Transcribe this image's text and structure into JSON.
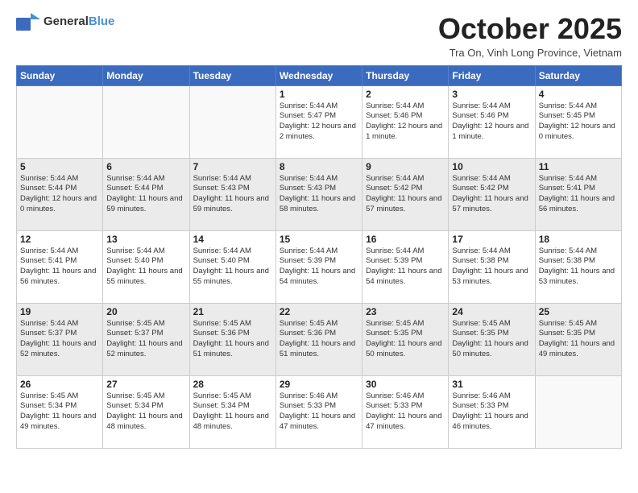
{
  "header": {
    "logo_general": "General",
    "logo_blue": "Blue",
    "month_title": "October 2025",
    "subtitle": "Tra On, Vinh Long Province, Vietnam"
  },
  "days_of_week": [
    "Sunday",
    "Monday",
    "Tuesday",
    "Wednesday",
    "Thursday",
    "Friday",
    "Saturday"
  ],
  "weeks": [
    [
      {
        "day": "",
        "info": ""
      },
      {
        "day": "",
        "info": ""
      },
      {
        "day": "",
        "info": ""
      },
      {
        "day": "1",
        "info": "Sunrise: 5:44 AM\nSunset: 5:47 PM\nDaylight: 12 hours\nand 2 minutes."
      },
      {
        "day": "2",
        "info": "Sunrise: 5:44 AM\nSunset: 5:46 PM\nDaylight: 12 hours\nand 1 minute."
      },
      {
        "day": "3",
        "info": "Sunrise: 5:44 AM\nSunset: 5:46 PM\nDaylight: 12 hours\nand 1 minute."
      },
      {
        "day": "4",
        "info": "Sunrise: 5:44 AM\nSunset: 5:45 PM\nDaylight: 12 hours\nand 0 minutes."
      }
    ],
    [
      {
        "day": "5",
        "info": "Sunrise: 5:44 AM\nSunset: 5:44 PM\nDaylight: 12 hours\nand 0 minutes."
      },
      {
        "day": "6",
        "info": "Sunrise: 5:44 AM\nSunset: 5:44 PM\nDaylight: 11 hours\nand 59 minutes."
      },
      {
        "day": "7",
        "info": "Sunrise: 5:44 AM\nSunset: 5:43 PM\nDaylight: 11 hours\nand 59 minutes."
      },
      {
        "day": "8",
        "info": "Sunrise: 5:44 AM\nSunset: 5:43 PM\nDaylight: 11 hours\nand 58 minutes."
      },
      {
        "day": "9",
        "info": "Sunrise: 5:44 AM\nSunset: 5:42 PM\nDaylight: 11 hours\nand 57 minutes."
      },
      {
        "day": "10",
        "info": "Sunrise: 5:44 AM\nSunset: 5:42 PM\nDaylight: 11 hours\nand 57 minutes."
      },
      {
        "day": "11",
        "info": "Sunrise: 5:44 AM\nSunset: 5:41 PM\nDaylight: 11 hours\nand 56 minutes."
      }
    ],
    [
      {
        "day": "12",
        "info": "Sunrise: 5:44 AM\nSunset: 5:41 PM\nDaylight: 11 hours\nand 56 minutes."
      },
      {
        "day": "13",
        "info": "Sunrise: 5:44 AM\nSunset: 5:40 PM\nDaylight: 11 hours\nand 55 minutes."
      },
      {
        "day": "14",
        "info": "Sunrise: 5:44 AM\nSunset: 5:40 PM\nDaylight: 11 hours\nand 55 minutes."
      },
      {
        "day": "15",
        "info": "Sunrise: 5:44 AM\nSunset: 5:39 PM\nDaylight: 11 hours\nand 54 minutes."
      },
      {
        "day": "16",
        "info": "Sunrise: 5:44 AM\nSunset: 5:39 PM\nDaylight: 11 hours\nand 54 minutes."
      },
      {
        "day": "17",
        "info": "Sunrise: 5:44 AM\nSunset: 5:38 PM\nDaylight: 11 hours\nand 53 minutes."
      },
      {
        "day": "18",
        "info": "Sunrise: 5:44 AM\nSunset: 5:38 PM\nDaylight: 11 hours\nand 53 minutes."
      }
    ],
    [
      {
        "day": "19",
        "info": "Sunrise: 5:44 AM\nSunset: 5:37 PM\nDaylight: 11 hours\nand 52 minutes."
      },
      {
        "day": "20",
        "info": "Sunrise: 5:45 AM\nSunset: 5:37 PM\nDaylight: 11 hours\nand 52 minutes."
      },
      {
        "day": "21",
        "info": "Sunrise: 5:45 AM\nSunset: 5:36 PM\nDaylight: 11 hours\nand 51 minutes."
      },
      {
        "day": "22",
        "info": "Sunrise: 5:45 AM\nSunset: 5:36 PM\nDaylight: 11 hours\nand 51 minutes."
      },
      {
        "day": "23",
        "info": "Sunrise: 5:45 AM\nSunset: 5:35 PM\nDaylight: 11 hours\nand 50 minutes."
      },
      {
        "day": "24",
        "info": "Sunrise: 5:45 AM\nSunset: 5:35 PM\nDaylight: 11 hours\nand 50 minutes."
      },
      {
        "day": "25",
        "info": "Sunrise: 5:45 AM\nSunset: 5:35 PM\nDaylight: 11 hours\nand 49 minutes."
      }
    ],
    [
      {
        "day": "26",
        "info": "Sunrise: 5:45 AM\nSunset: 5:34 PM\nDaylight: 11 hours\nand 49 minutes."
      },
      {
        "day": "27",
        "info": "Sunrise: 5:45 AM\nSunset: 5:34 PM\nDaylight: 11 hours\nand 48 minutes."
      },
      {
        "day": "28",
        "info": "Sunrise: 5:45 AM\nSunset: 5:34 PM\nDaylight: 11 hours\nand 48 minutes."
      },
      {
        "day": "29",
        "info": "Sunrise: 5:46 AM\nSunset: 5:33 PM\nDaylight: 11 hours\nand 47 minutes."
      },
      {
        "day": "30",
        "info": "Sunrise: 5:46 AM\nSunset: 5:33 PM\nDaylight: 11 hours\nand 47 minutes."
      },
      {
        "day": "31",
        "info": "Sunrise: 5:46 AM\nSunset: 5:33 PM\nDaylight: 11 hours\nand 46 minutes."
      },
      {
        "day": "",
        "info": ""
      }
    ]
  ]
}
